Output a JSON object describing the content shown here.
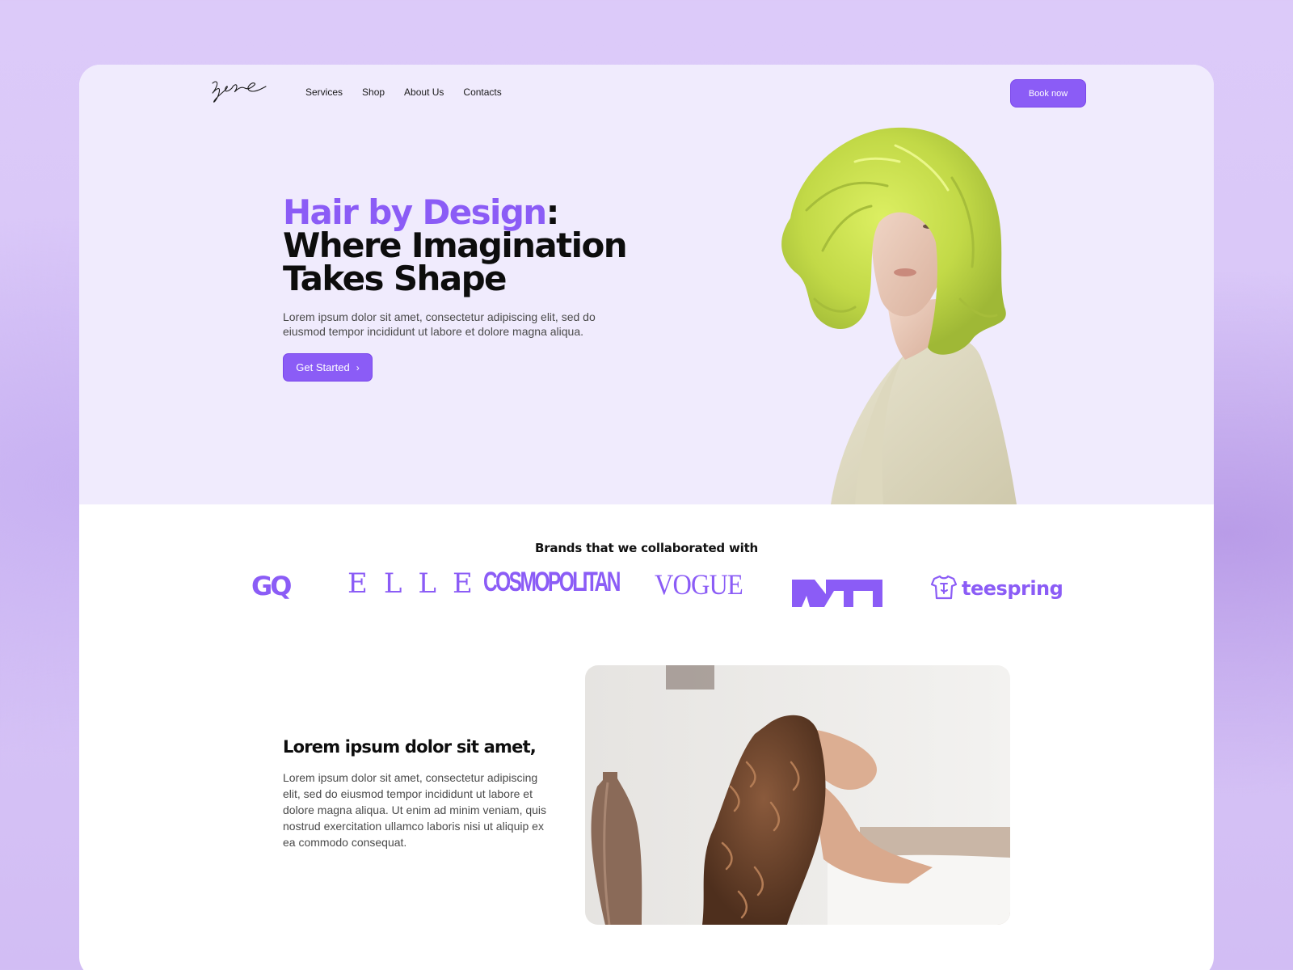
{
  "nav": {
    "items": [
      "Services",
      "Shop",
      "About Us",
      "Contacts"
    ],
    "cta": "Book now"
  },
  "hero": {
    "title_accent": "Hair by Design",
    "title_colon": ":",
    "title_line2": "Where Imagination",
    "title_line3": "Takes Shape",
    "description": "Lorem ipsum dolor sit amet, consectetur adipiscing elit, sed do eiusmod tempor incididunt ut labore et dolore magna aliqua.",
    "button": "Get Started",
    "button_icon": "chevron-right-icon"
  },
  "brands": {
    "title": "Brands that we collaborated with",
    "items": [
      "GQ",
      "ELLE",
      "COSMOPOLITAN",
      "VOGUE",
      "MTV",
      "teespring"
    ]
  },
  "feature": {
    "title": "Lorem ipsum dolor sit amet,",
    "body": "Lorem ipsum dolor sit amet, consectetur adipiscing elit, sed do eiusmod tempor incididunt ut labore et dolore magna aliqua. Ut enim ad minim veniam, quis nostrud exercitation ullamco laboris nisi ut aliquip ex ea commodo consequat."
  },
  "colors": {
    "accent": "#8b5cf6",
    "hero_bg": "#f0ebfd",
    "page_bg": "#dccaf9",
    "hair_green": "#c9e04a"
  }
}
